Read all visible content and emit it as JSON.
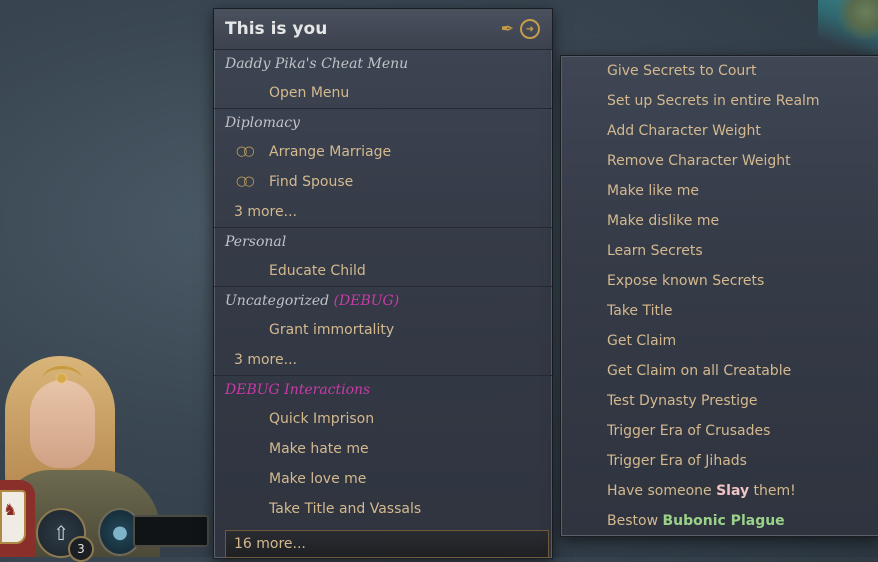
{
  "main_menu": {
    "title": "This is you",
    "sections": {
      "cheat": {
        "title": "Daddy Pika's Cheat Menu",
        "items": [
          "Open Menu"
        ]
      },
      "diplomacy": {
        "title": "Diplomacy",
        "items": [
          "Arrange Marriage",
          "Find Spouse"
        ],
        "more": "3 more..."
      },
      "personal": {
        "title": "Personal",
        "items": [
          "Educate Child"
        ]
      },
      "uncategorized": {
        "title": "Uncategorized",
        "suffix": "(DEBUG)",
        "items": [
          "Grant immortality"
        ],
        "more": "3 more..."
      },
      "debug": {
        "title": "DEBUG Interactions",
        "items": [
          "Quick Imprison",
          "Make hate me",
          "Make love me",
          "Take Title and Vassals"
        ]
      }
    },
    "more_button": "16 more..."
  },
  "sub_menu": {
    "items": [
      "Give Secrets to Court",
      "Set up Secrets in entire Realm",
      "Add Character Weight",
      "Remove Character Weight",
      "Make like me",
      "Make dislike me",
      "Learn Secrets",
      "Expose known Secrets",
      "Take Title",
      "Get Claim",
      "Get Claim on all Creatable",
      "Test Dynasty Prestige",
      "Trigger Era of Crusades",
      "Trigger Era of Jihads"
    ],
    "slay_item": {
      "prefix": "Have someone ",
      "highlight": "Slay",
      "suffix": " them!"
    },
    "plague_item": {
      "prefix": "Bestow ",
      "highlight": "Bubonic Plague"
    }
  },
  "hud": {
    "badge_count": "3"
  },
  "icons": {
    "pen": "pen-icon",
    "exit": "circle-arrow-icon",
    "rings": "rings-icon"
  }
}
